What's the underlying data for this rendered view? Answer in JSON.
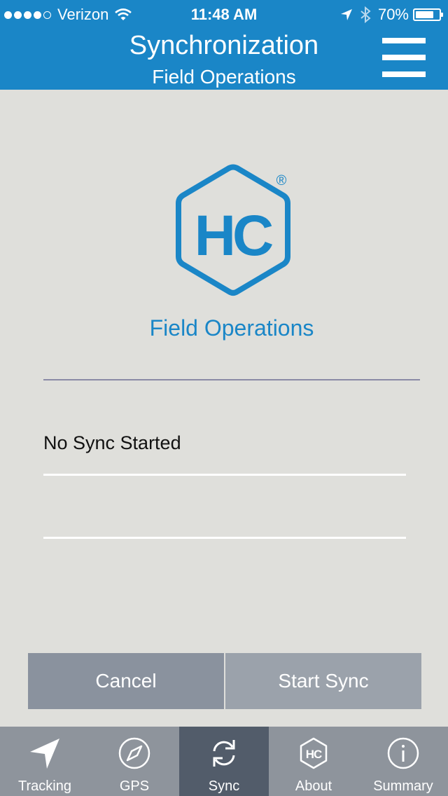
{
  "status_bar": {
    "carrier": "Verizon",
    "time": "11:48 AM",
    "battery": "70%",
    "battery_level": 0.7
  },
  "header": {
    "title": "Synchronization",
    "subtitle": "Field Operations",
    "menu_icon": "hamburger-menu-icon"
  },
  "logo": {
    "text": "HC",
    "mark": "®",
    "color": "#1a86c7"
  },
  "main": {
    "app_name": "Field Operations",
    "sync_status": "No Sync Started"
  },
  "buttons": {
    "cancel": "Cancel",
    "start_sync": "Start Sync"
  },
  "tabs": [
    {
      "label": "Tracking",
      "icon": "location-arrow-icon",
      "active": false
    },
    {
      "label": "GPS",
      "icon": "compass-icon",
      "active": false
    },
    {
      "label": "Sync",
      "icon": "sync-icon",
      "active": true
    },
    {
      "label": "About",
      "icon": "hc-logo-icon",
      "active": false
    },
    {
      "label": "Summary",
      "icon": "info-icon",
      "active": false
    }
  ],
  "colors": {
    "header": "#1a86c7",
    "background": "#dfdfdb",
    "tabbar": "#8e949c",
    "tab_active": "#525c6a"
  }
}
